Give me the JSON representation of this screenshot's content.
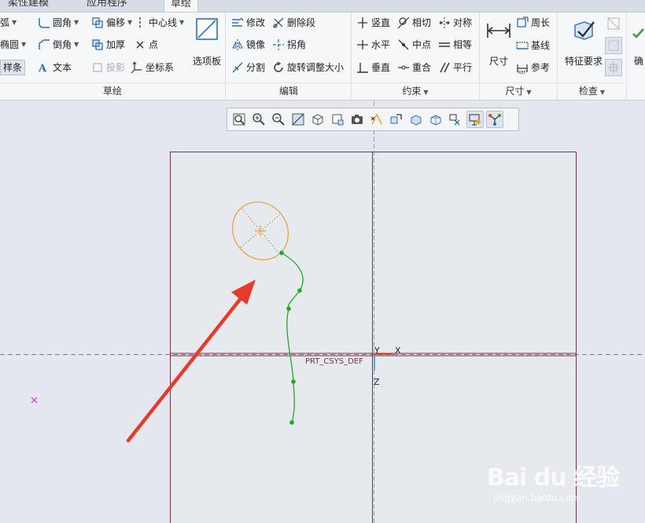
{
  "tabs": [
    {
      "label": "柔性建模"
    },
    {
      "label": "应用程序"
    },
    {
      "label": "草绘"
    }
  ],
  "ribbon": {
    "sketch_group": {
      "label": "草绘",
      "arc": "弧",
      "fillet": "圆角",
      "offset": "偏移",
      "centerline": "中心线",
      "ellipse": "椭圆",
      "chamfer": "倒角",
      "thicken": "加厚",
      "point": "点",
      "spline": "样条",
      "text": "文本",
      "project": "投影",
      "csys": "坐标系",
      "palette": "选项板"
    },
    "edit_group": {
      "label": "编辑",
      "modify": "修改",
      "delete_segment": "删除段",
      "mirror": "镜像",
      "corner": "拐角",
      "divide": "分割",
      "rotate_resize": "旋转调整大小"
    },
    "constrain_group": {
      "label": "约束",
      "vertical": "竖直",
      "tangent": "相切",
      "symmetric": "对称",
      "horizontal": "水平",
      "midpoint": "中点",
      "equal": "相等",
      "perpendicular": "垂直",
      "coincident": "重合",
      "parallel": "平行"
    },
    "dimension_group": {
      "label": "尺寸",
      "dimension": "尺寸",
      "perimeter": "周长",
      "baseline": "基线",
      "reference": "参考"
    },
    "inspect_group": {
      "label": "检查",
      "feature_requirements": "特征要求"
    },
    "ok_button": {
      "label": "确"
    }
  },
  "canvas": {
    "csys_label": "PRT_CSYS_DEF",
    "axis_y": "Y",
    "axis_x": "X",
    "axis_z": "Z"
  },
  "colors": {
    "ellipse": "#e8a030",
    "spline": "#22aa22",
    "frame": "#7a3040",
    "axis": "#c8a020",
    "dashed": "#2aa0b0",
    "arrow": "#e83a2a"
  },
  "watermark": {
    "brand": "Bai du 经验",
    "url": "jingyan.baidu.com"
  }
}
